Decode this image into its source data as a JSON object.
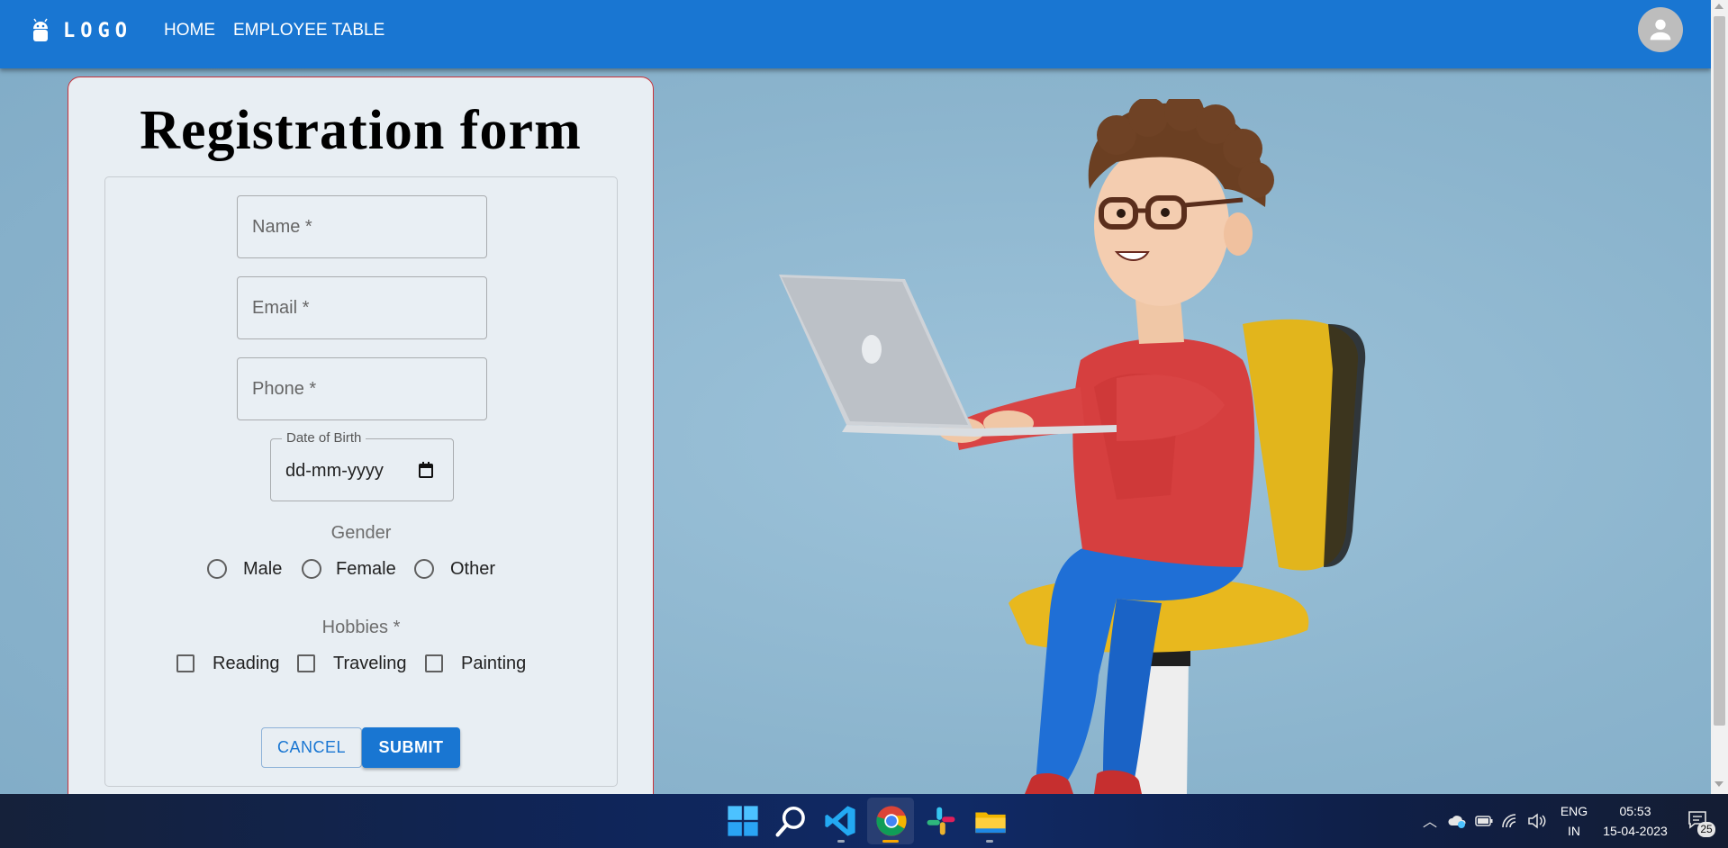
{
  "appbar": {
    "logo_text": "LOGO",
    "nav": [
      {
        "label": "HOME"
      },
      {
        "label": "EMPLOYEE TABLE"
      }
    ],
    "color": "#1976d2"
  },
  "form": {
    "title": "Registration form",
    "name_placeholder": "Name *",
    "email_placeholder": "Email *",
    "phone_placeholder": "Phone *",
    "dob_label": "Date of Birth",
    "dob_value": "dd-mm-yyyy",
    "gender_label": "Gender",
    "gender_options": [
      "Male",
      "Female",
      "Other"
    ],
    "hobbies_label": "Hobbies *",
    "hobby_options": [
      "Reading",
      "Traveling",
      "Painting"
    ],
    "cancel_label": "CANCEL",
    "submit_label": "SUBMIT",
    "border_color": "#c8323a"
  },
  "taskbar": {
    "apps": [
      "windows-start",
      "search",
      "vscode",
      "chrome",
      "slack",
      "file-explorer"
    ],
    "language": "ENG",
    "region": "IN",
    "time": "05:53",
    "date": "15-04-2023",
    "notification_count": "25"
  }
}
